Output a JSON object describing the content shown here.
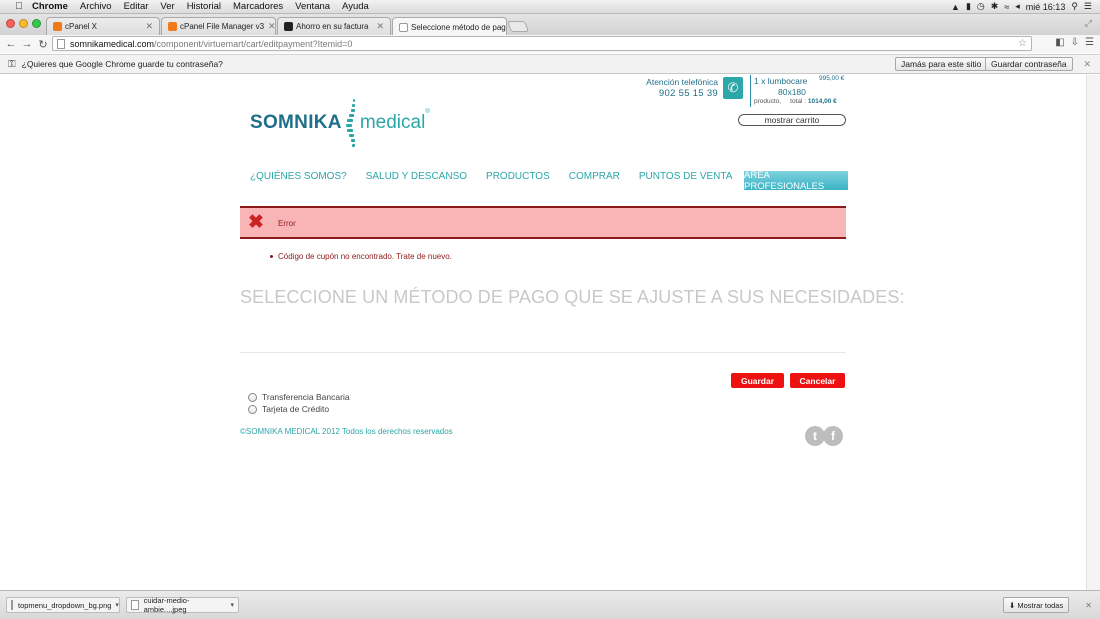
{
  "menubar": {
    "app_name": "Chrome",
    "items": [
      "Archivo",
      "Editar",
      "Ver",
      "Historial",
      "Marcadores",
      "Ventana",
      "Ayuda"
    ],
    "clock": "mié 16:13"
  },
  "tabs": [
    {
      "title": "cPanel X",
      "favicon_color": "#f07a1a"
    },
    {
      "title": "cPanel File Manager v3",
      "favicon_color": "#f07a1a"
    },
    {
      "title": "Ahorro en su factura",
      "favicon_color": "#222222"
    },
    {
      "title": "Seleccione método de pago",
      "favicon_color": "#ffffff"
    }
  ],
  "address_bar": {
    "domain": "somnikamedical.com",
    "path": "/component/virtuemart/cart/editpayment?Itemid=0"
  },
  "infobar": {
    "question": "¿Quieres que Google Chrome guarde tu contraseña?",
    "never_label": "Jamás para este sitio",
    "save_label": "Guardar contraseña"
  },
  "header": {
    "phone_label": "Atención telefónica",
    "phone_number": "902 55 15 39",
    "cart": {
      "line1": "1 x lumbocare",
      "line2": "80x180",
      "item_price": "995,00 €",
      "meta_label": "producto,",
      "total_label": "total :",
      "total_value": "1014,00 €",
      "show_cart_label": "mostrar carrito"
    }
  },
  "logo": {
    "part1": "SOMNIKA",
    "part2": "medical",
    "mark": "®"
  },
  "nav": {
    "items": [
      "¿QUIÉNES SOMOS?",
      "SALUD Y DESCANSO",
      "PRODUCTOS",
      "COMPRAR",
      "PUNTOS DE VENTA"
    ],
    "pro_label": "ÁREA PROFESIONALES"
  },
  "error": {
    "title": "Error",
    "message": "Código de cupón no encontrado. Trate de nuevo."
  },
  "main": {
    "title": "SELECCIONE UN MÉTODO DE PAGO QUE SE AJUSTE A SUS NECESIDADES:",
    "save_label": "Guardar",
    "cancel_label": "Cancelar",
    "payment_options": [
      "Transferencia Bancaria",
      "Tarjeta de Crédito"
    ]
  },
  "footer": {
    "copyright": "©SOMNIKA MEDICAL 2012 Todos los derechos reservados",
    "social": [
      "t",
      "f"
    ]
  },
  "downloads": {
    "items": [
      "topmenu_dropdown_bg.png",
      "cuidar-medio-ambie....jpeg"
    ],
    "show_all_label": "Mostrar todas"
  },
  "colors": {
    "brand_teal": "#2ba7a8",
    "brand_blue": "#1f6f8b",
    "error_bg": "#f9b5b5",
    "error_text": "#8b1a1a",
    "button_red": "#ee1111"
  }
}
